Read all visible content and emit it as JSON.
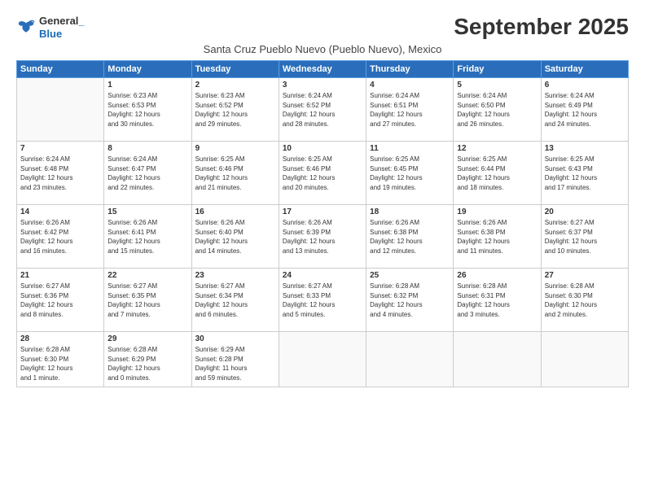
{
  "logo": {
    "line1": "General",
    "line2": "Blue"
  },
  "title": "September 2025",
  "subtitle": "Santa Cruz Pueblo Nuevo (Pueblo Nuevo), Mexico",
  "days_header": [
    "Sunday",
    "Monday",
    "Tuesday",
    "Wednesday",
    "Thursday",
    "Friday",
    "Saturday"
  ],
  "weeks": [
    [
      {
        "day": "",
        "text": ""
      },
      {
        "day": "1",
        "text": "Sunrise: 6:23 AM\nSunset: 6:53 PM\nDaylight: 12 hours\nand 30 minutes."
      },
      {
        "day": "2",
        "text": "Sunrise: 6:23 AM\nSunset: 6:52 PM\nDaylight: 12 hours\nand 29 minutes."
      },
      {
        "day": "3",
        "text": "Sunrise: 6:24 AM\nSunset: 6:52 PM\nDaylight: 12 hours\nand 28 minutes."
      },
      {
        "day": "4",
        "text": "Sunrise: 6:24 AM\nSunset: 6:51 PM\nDaylight: 12 hours\nand 27 minutes."
      },
      {
        "day": "5",
        "text": "Sunrise: 6:24 AM\nSunset: 6:50 PM\nDaylight: 12 hours\nand 26 minutes."
      },
      {
        "day": "6",
        "text": "Sunrise: 6:24 AM\nSunset: 6:49 PM\nDaylight: 12 hours\nand 24 minutes."
      }
    ],
    [
      {
        "day": "7",
        "text": "Sunrise: 6:24 AM\nSunset: 6:48 PM\nDaylight: 12 hours\nand 23 minutes."
      },
      {
        "day": "8",
        "text": "Sunrise: 6:24 AM\nSunset: 6:47 PM\nDaylight: 12 hours\nand 22 minutes."
      },
      {
        "day": "9",
        "text": "Sunrise: 6:25 AM\nSunset: 6:46 PM\nDaylight: 12 hours\nand 21 minutes."
      },
      {
        "day": "10",
        "text": "Sunrise: 6:25 AM\nSunset: 6:46 PM\nDaylight: 12 hours\nand 20 minutes."
      },
      {
        "day": "11",
        "text": "Sunrise: 6:25 AM\nSunset: 6:45 PM\nDaylight: 12 hours\nand 19 minutes."
      },
      {
        "day": "12",
        "text": "Sunrise: 6:25 AM\nSunset: 6:44 PM\nDaylight: 12 hours\nand 18 minutes."
      },
      {
        "day": "13",
        "text": "Sunrise: 6:25 AM\nSunset: 6:43 PM\nDaylight: 12 hours\nand 17 minutes."
      }
    ],
    [
      {
        "day": "14",
        "text": "Sunrise: 6:26 AM\nSunset: 6:42 PM\nDaylight: 12 hours\nand 16 minutes."
      },
      {
        "day": "15",
        "text": "Sunrise: 6:26 AM\nSunset: 6:41 PM\nDaylight: 12 hours\nand 15 minutes."
      },
      {
        "day": "16",
        "text": "Sunrise: 6:26 AM\nSunset: 6:40 PM\nDaylight: 12 hours\nand 14 minutes."
      },
      {
        "day": "17",
        "text": "Sunrise: 6:26 AM\nSunset: 6:39 PM\nDaylight: 12 hours\nand 13 minutes."
      },
      {
        "day": "18",
        "text": "Sunrise: 6:26 AM\nSunset: 6:38 PM\nDaylight: 12 hours\nand 12 minutes."
      },
      {
        "day": "19",
        "text": "Sunrise: 6:26 AM\nSunset: 6:38 PM\nDaylight: 12 hours\nand 11 minutes."
      },
      {
        "day": "20",
        "text": "Sunrise: 6:27 AM\nSunset: 6:37 PM\nDaylight: 12 hours\nand 10 minutes."
      }
    ],
    [
      {
        "day": "21",
        "text": "Sunrise: 6:27 AM\nSunset: 6:36 PM\nDaylight: 12 hours\nand 8 minutes."
      },
      {
        "day": "22",
        "text": "Sunrise: 6:27 AM\nSunset: 6:35 PM\nDaylight: 12 hours\nand 7 minutes."
      },
      {
        "day": "23",
        "text": "Sunrise: 6:27 AM\nSunset: 6:34 PM\nDaylight: 12 hours\nand 6 minutes."
      },
      {
        "day": "24",
        "text": "Sunrise: 6:27 AM\nSunset: 6:33 PM\nDaylight: 12 hours\nand 5 minutes."
      },
      {
        "day": "25",
        "text": "Sunrise: 6:28 AM\nSunset: 6:32 PM\nDaylight: 12 hours\nand 4 minutes."
      },
      {
        "day": "26",
        "text": "Sunrise: 6:28 AM\nSunset: 6:31 PM\nDaylight: 12 hours\nand 3 minutes."
      },
      {
        "day": "27",
        "text": "Sunrise: 6:28 AM\nSunset: 6:30 PM\nDaylight: 12 hours\nand 2 minutes."
      }
    ],
    [
      {
        "day": "28",
        "text": "Sunrise: 6:28 AM\nSunset: 6:30 PM\nDaylight: 12 hours\nand 1 minute."
      },
      {
        "day": "29",
        "text": "Sunrise: 6:28 AM\nSunset: 6:29 PM\nDaylight: 12 hours\nand 0 minutes."
      },
      {
        "day": "30",
        "text": "Sunrise: 6:29 AM\nSunset: 6:28 PM\nDaylight: 11 hours\nand 59 minutes."
      },
      {
        "day": "",
        "text": ""
      },
      {
        "day": "",
        "text": ""
      },
      {
        "day": "",
        "text": ""
      },
      {
        "day": "",
        "text": ""
      }
    ]
  ]
}
